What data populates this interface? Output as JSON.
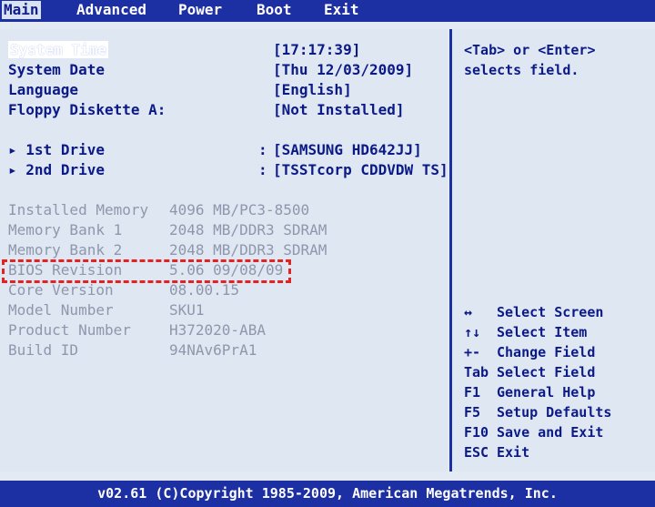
{
  "menu": [
    "Main",
    "Advanced",
    "Power",
    "Boot",
    "Exit"
  ],
  "active_menu": "Main",
  "main": {
    "system_time_label": "System Time",
    "system_time_value": "[17:17:39]",
    "system_date_label": "System Date",
    "system_date_value": "[Thu 12/03/2009]",
    "language_label": "Language",
    "language_value": "[English]",
    "floppy_label": "Floppy Diskette A:",
    "floppy_value": "[Not Installed]",
    "drive1_label": "1st Drive",
    "drive1_value": "[SAMSUNG HD642JJ]",
    "drive2_label": "2nd Drive",
    "drive2_value": "[TSSTcorp CDDVDW TS]",
    "info": [
      {
        "label": "Installed Memory",
        "value": "4096 MB/PC3-8500"
      },
      {
        "label": "Memory Bank 1",
        "value": "2048 MB/DDR3 SDRAM"
      },
      {
        "label": "Memory Bank 2",
        "value": "2048 MB/DDR3 SDRAM"
      },
      {
        "label": "BIOS Revision",
        "value": "5.06 09/08/09"
      },
      {
        "label": "Core Version",
        "value": "08.00.15"
      },
      {
        "label": "Model Number",
        "value": "SKU1"
      },
      {
        "label": "Product Number",
        "value": "H372020-ABA"
      },
      {
        "label": "Build ID",
        "value": "94NAv6PrA1"
      }
    ]
  },
  "help": {
    "line1": "<Tab> or <Enter>",
    "line2": "selects field.",
    "keys": [
      {
        "key": "↔",
        "desc": "Select Screen"
      },
      {
        "key": "↑↓",
        "desc": "Select Item"
      },
      {
        "key": "+-",
        "desc": "Change Field"
      },
      {
        "key": "Tab",
        "desc": "Select Field"
      },
      {
        "key": "F1",
        "desc": "General Help"
      },
      {
        "key": "F5",
        "desc": "Setup Defaults"
      },
      {
        "key": "F10",
        "desc": "Save and Exit"
      },
      {
        "key": "ESC",
        "desc": "Exit"
      }
    ]
  },
  "footer": "v02.61 (C)Copyright 1985-2009, American Megatrends, Inc.",
  "colors": {
    "blue": "#1c2fa3",
    "panel": "#dfe7f2",
    "highlight_red": "#e32222"
  }
}
